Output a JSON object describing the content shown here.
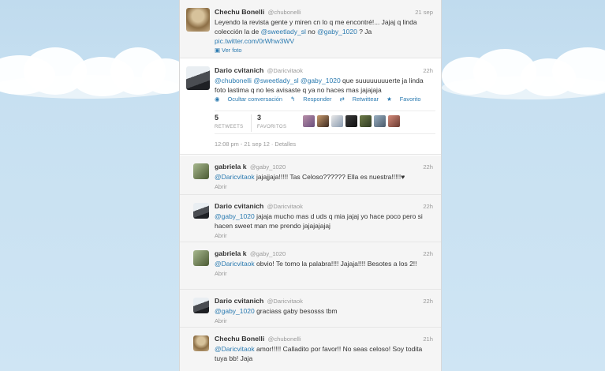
{
  "colors": {
    "link": "#2a7ab0",
    "background": "#c7e0f1"
  },
  "tweets": [
    {
      "name": "Chechu Bonelli",
      "handle": "@chubonelli",
      "time": "21 sep",
      "text_pre": "Leyendo la revista gente y miren cn lo q me encontré!... Jajaj q linda colección la de",
      "mention_1": "@sweetlady_sl",
      "text_mid": "no",
      "mention_2": "@gaby_1020",
      "text_post": "? Ja",
      "link": "pic.twitter.com/0rWhw3WV",
      "photo_label": "Ver foto",
      "photo_icon": "photo-icon"
    },
    {
      "name": "Dario cvitanich",
      "handle": "@Daricvitaok",
      "time": "22h",
      "mention_1": "@chubonelli",
      "mention_2": "@sweetlady_sl",
      "mention_3": "@gaby_1020",
      "text": "que suuuuuuuuerte ja linda foto lastima q no les avisaste q ya no haces mas jajajaja",
      "actions": {
        "hide": "Ocultar conversación",
        "reply": "Responder",
        "retweet": "Retwittear",
        "favorite": "Favorito"
      },
      "retweets_count": "5",
      "retweets_label": "RETWEETS",
      "favorites_count": "3",
      "favorites_label": "FAVORITOS",
      "meta": "12:08 pm - 21 sep 12 · Detalles"
    },
    {
      "name": "gabriela k",
      "handle": "@gaby_1020",
      "time": "22h",
      "mention": "@Daricvitaok",
      "text": "jajajjaja!!!!! Tas Celoso?????? Ella es nuestra!!!!!♥",
      "sub": "Abrir"
    },
    {
      "name": "Dario cvitanich",
      "handle": "@Daricvitaok",
      "time": "22h",
      "mention": "@gaby_1020",
      "text": "jajaja mucho mas d uds q mia jajaj yo hace poco pero si hacen sweet man me prendo jajajajajaj",
      "sub": "Abrir"
    },
    {
      "name": "gabriela k",
      "handle": "@gaby_1020",
      "time": "22h",
      "mention": "@Daricvitaok",
      "text": "obvio! Te tomo la palabra!!!! Jajaja!!!! Besotes a los 2!!",
      "sub": "Abrir"
    },
    {
      "name": "Dario cvitanich",
      "handle": "@Daricvitaok",
      "time": "22h",
      "mention": "@gaby_1020",
      "text": "graciass gaby besosss tbm",
      "sub": "Abrir"
    },
    {
      "name": "Chechu Bonelli",
      "handle": "@chubonelli",
      "time": "21h",
      "mention": "@Daricvitaok",
      "text": "amor!!!!! Calladito por favor!! No seas celoso! Soy todita tuya bb! Jaja"
    }
  ]
}
